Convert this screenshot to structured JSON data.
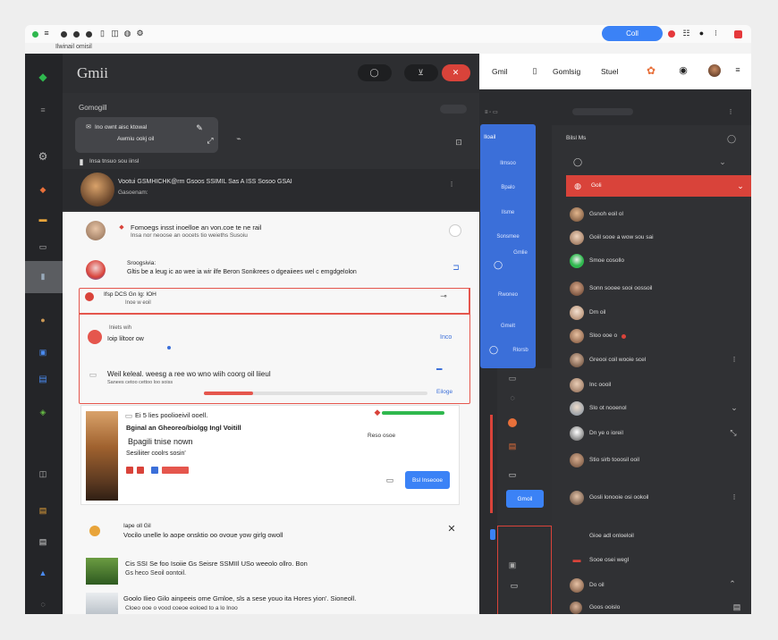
{
  "browser": {
    "tab_label": "Ilwinail omisil",
    "call_button": "Coll"
  },
  "gmail": {
    "logo": "Gmii",
    "section_title": "Gomogill",
    "note": {
      "line1": "Ino ownt aisc ktowal",
      "line2": "Awmiu ookj oil"
    },
    "draft_row": "Insa tnsuo sou iinsl",
    "promo_row": {
      "title": "Vootui  GSMHICHK@rm Gsoos  SSIMIL  Sas  A ISS  Sosoo  GSAI",
      "sub": "Gasoenam:"
    }
  },
  "mails": [
    {
      "title": "Fomoegs insst inoelloe an von.coe  te ne rail",
      "sub": "Insa nor neoose an oocets tio weieths Susoiu",
      "highlighted": false
    },
    {
      "title": "Sroogsivia:",
      "sub": "Gltis be a leug ic ao wee ia wir ilfe Beron Sonikrees o dgeaiiees wel c emgdgelolon",
      "highlighted": false
    },
    {
      "title": "Ifsp DCS Gn Ig: IOH",
      "sub": "Inoe w eoil",
      "highlighted": true
    },
    {
      "title": "Iniets wih",
      "sub": "Ioip liltoor ow",
      "highlighted": true
    },
    {
      "title": "Weil keleal. weesg a ree wo wno wiih coorg oil liieul",
      "sub": "Sanees cetoo cettoo loo soiss",
      "highlighted": true
    },
    {
      "title": "Ei  5  lies poolioeivil  ooell.",
      "sub": "Bginal an Gheoreo/biolgg Ingl  Voitill",
      "highlighted": false
    },
    {
      "title": "Bpagili tnise nown",
      "sub": "Sesiliiter coolrs sosin'",
      "highlighted": false
    },
    {
      "title": "Iape oll Gil",
      "sub": "Vocilo unelle lo aope onsktio oo ovoue yow girlg owoll",
      "highlighted": false
    },
    {
      "title": "Cis SSI Se foo Isoiie Gs Seisre  SSMIIl  USo weeolo ollro. Bon",
      "sub": "Gs heco  Seoil oontoil.",
      "highlighted": false
    },
    {
      "title": "Goolo  Ilieo Gilo ainpeeis ome Gmloe, sls a sese youo ita Hores yion'.  Sioneoll.",
      "sub": "Cloeo ooe o vood coeoe eoloed to a lo Inoo",
      "highlighted": false
    }
  ],
  "actions": {
    "send_button": "Bsl Inseooe",
    "reply_label": "Inco",
    "forward_label": "Eiloge",
    "date_label": "Reso osoe"
  },
  "right_panel": {
    "header_items": [
      "Gmil",
      "Gomlsig",
      "Stuel"
    ],
    "blue_panel_title": "Iloail",
    "blue_panel_items": [
      "Ilmsoo",
      "Bpalo",
      "Ilsme",
      "Sonsmee",
      "Gmlie",
      "Rwoneo",
      "Gmelt",
      "Rlorsb"
    ],
    "contacts_header": "Bilsl Ms",
    "contacts": [
      "Goli",
      "Gsnoh eoil ol",
      "Goiil sooe a wow sou sai",
      "Smoe cosollo",
      "Sonn sooee sooi oossoil",
      "Dm oil",
      "Sloo ooe o",
      "Greooi coil  wooie scel",
      "Inc oooil",
      "Slo ot nooenol",
      "Dn ye o  ioreil",
      "Stio sirb tooosil ooil",
      "Gosli lonooie osi ookoil",
      "Gioe adl onloeloil",
      "Sooe osei wegl",
      "Do oil",
      "Goos ooislo"
    ],
    "compose_button": "Gmoil"
  }
}
